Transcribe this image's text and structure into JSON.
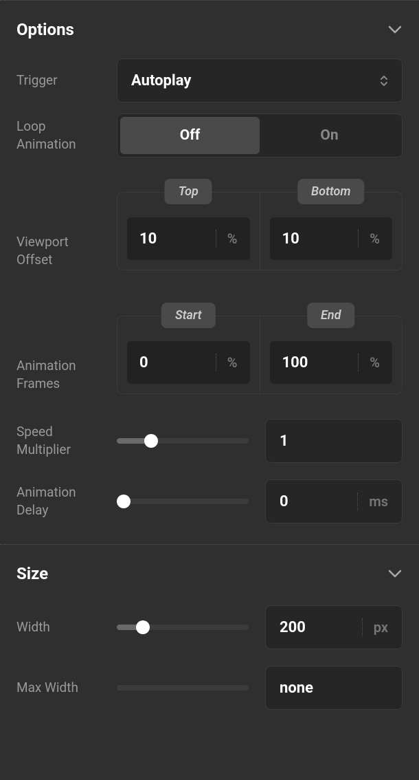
{
  "sections": {
    "options": {
      "title": "Options",
      "trigger": {
        "label": "Trigger",
        "value": "Autoplay"
      },
      "loop": {
        "label": "Loop Animation",
        "off": "Off",
        "on": "On",
        "selected": "off"
      },
      "viewport_offset": {
        "label": "Viewport Offset",
        "top": {
          "tab": "Top",
          "value": "10",
          "unit": "%"
        },
        "bottom": {
          "tab": "Bottom",
          "value": "10",
          "unit": "%"
        }
      },
      "animation_frames": {
        "label": "Animation Frames",
        "start": {
          "tab": "Start",
          "value": "0",
          "unit": "%"
        },
        "end": {
          "tab": "End",
          "value": "100",
          "unit": "%"
        }
      },
      "speed": {
        "label": "Speed Multiplier",
        "value": "1",
        "percent": 26
      },
      "delay": {
        "label": "Animation Delay",
        "value": "0",
        "unit": "ms",
        "percent": 0
      }
    },
    "size": {
      "title": "Size",
      "width": {
        "label": "Width",
        "value": "200",
        "unit": "px",
        "percent": 20
      },
      "max_width": {
        "label": "Max Width",
        "value": "none",
        "percent": 0
      }
    }
  }
}
